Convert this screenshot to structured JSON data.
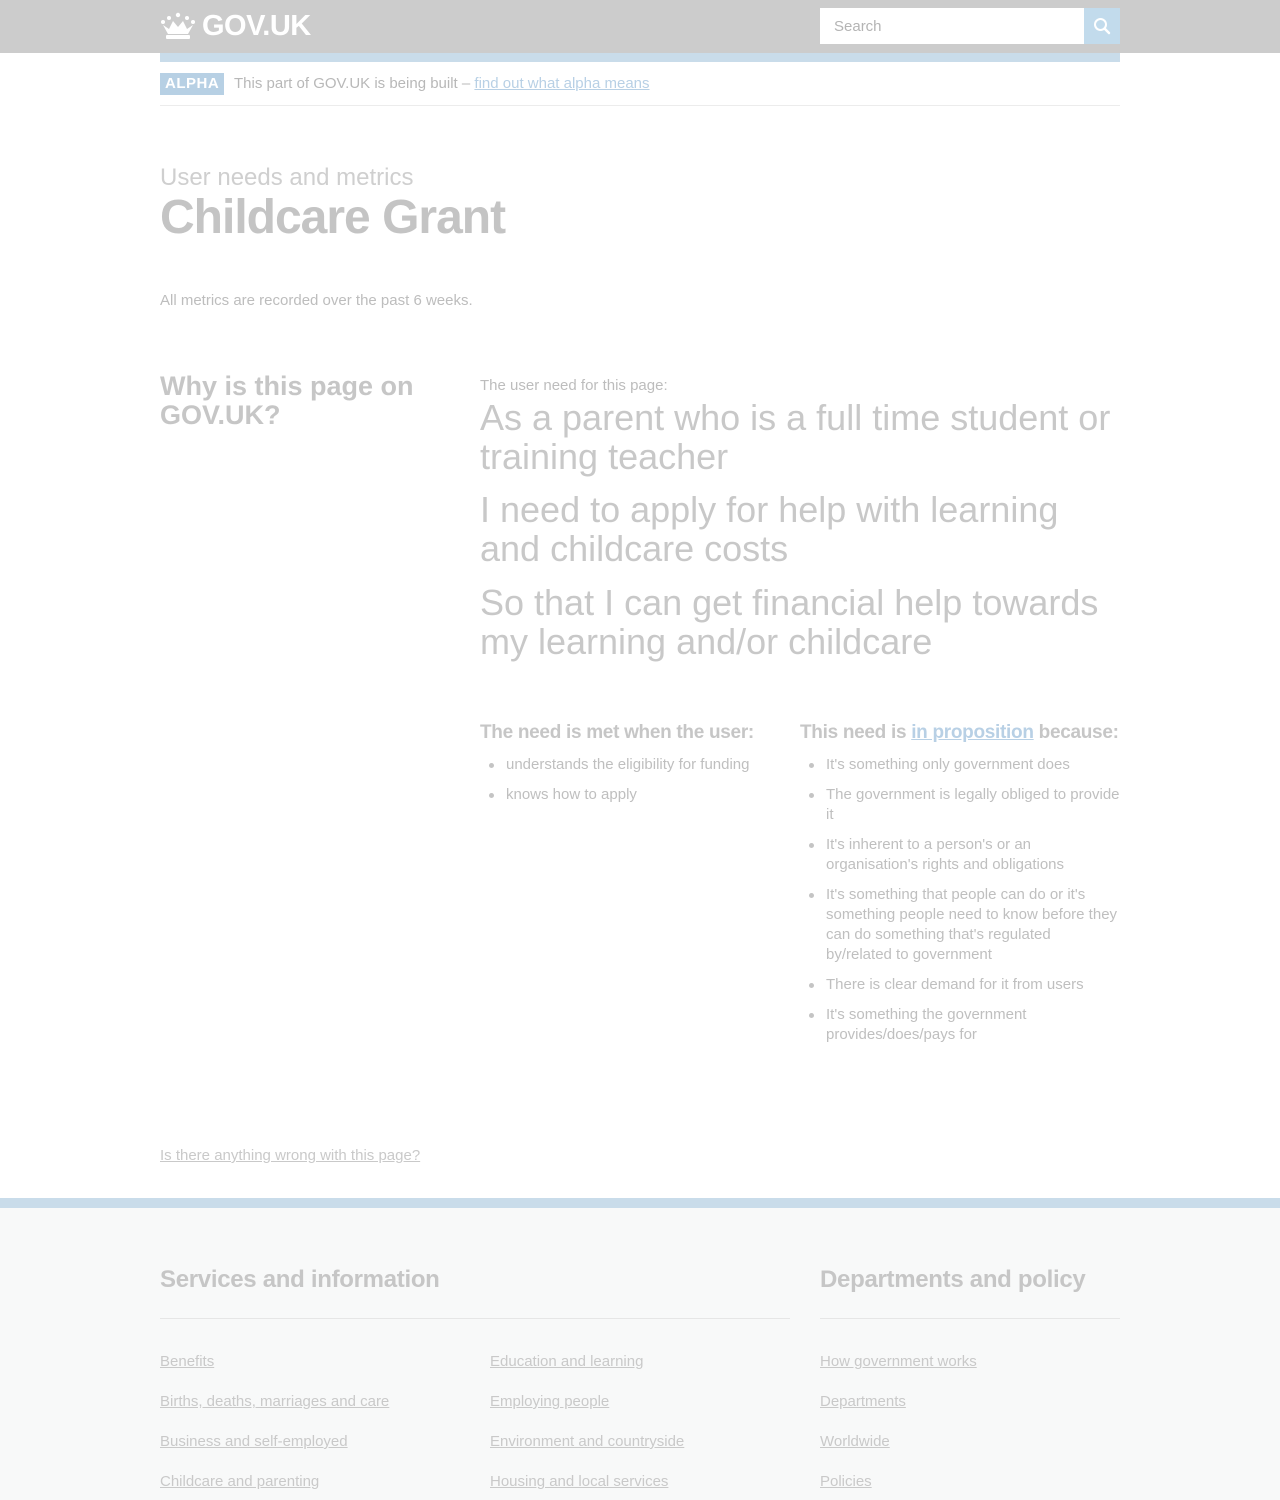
{
  "header": {
    "logo_text": "GOV.UK",
    "search_placeholder": "Search",
    "accent_color": "#c9dcea"
  },
  "phase_banner": {
    "tag": "ALPHA",
    "text": "This part of GOV.UK is being built –",
    "link": "find out what alpha means"
  },
  "page": {
    "caption": "User needs and metrics",
    "title": "Childcare Grant",
    "metrics_note": "All metrics are recorded over the past 6 weeks."
  },
  "why": {
    "heading": "Why is this page on GOV.UK?",
    "need_label": "The user need for this page:",
    "as_a": "As a parent who is a full time student or training teacher",
    "i_need": "I need to apply for help with learning and childcare costs",
    "so_that": "So that I can get financial help towards my learning and/or childcare"
  },
  "met_when": {
    "heading": "The need is met when the user:",
    "items": [
      "understands the eligibility for funding",
      "knows how to apply"
    ]
  },
  "proposition": {
    "heading_prefix": "This need is",
    "heading_link": "in proposition",
    "heading_suffix": "because:",
    "items": [
      "It's something only government does",
      "The government is legally obliged to provide it",
      "It's inherent to a person's or an organisation's rights and obligations",
      "It's something that people can do or it's something people need to know before they can do something that's regulated by/related to government",
      "There is clear demand for it from users",
      "It's something the government provides/does/pays for"
    ]
  },
  "report_link": "Is there anything wrong with this page?",
  "footer": {
    "services_heading": "Services and information",
    "departments_heading": "Departments and policy",
    "services_col1": [
      "Benefits",
      "Births, deaths, marriages and care",
      "Business and self-employed",
      "Childcare and parenting"
    ],
    "services_col2": [
      "Education and learning",
      "Employing people",
      "Environment and countryside",
      "Housing and local services"
    ],
    "departments": [
      "How government works",
      "Departments",
      "Worldwide",
      "Policies"
    ]
  }
}
